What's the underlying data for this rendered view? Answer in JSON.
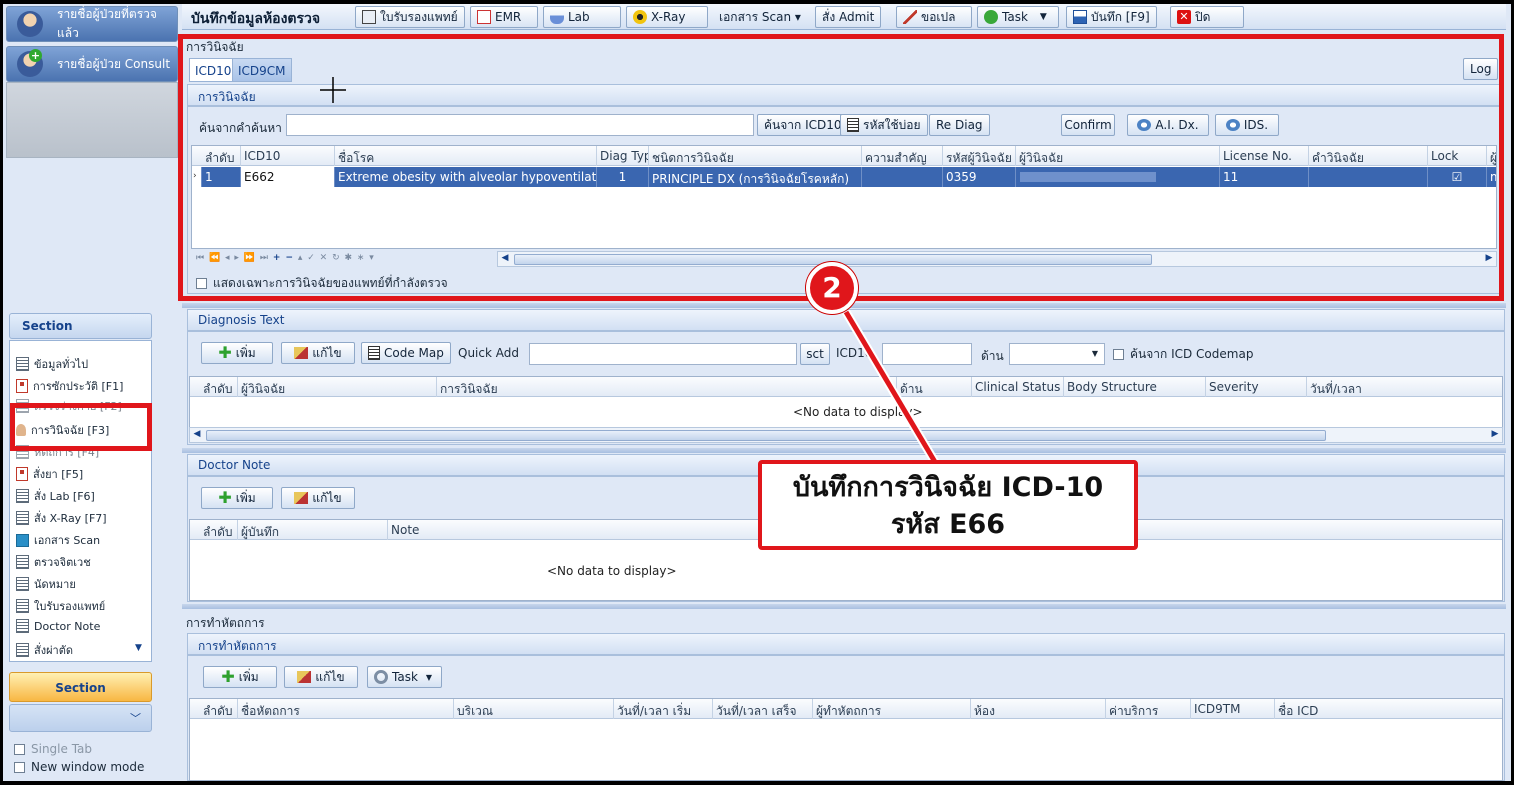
{
  "sidebar": {
    "patients_checked": "รายชื่อผู้ป่วยที่ตรวจแล้ว",
    "patients_consult": "รายชื่อผู้ป่วย Consult",
    "section_header": "Section",
    "items": [
      {
        "label": "ข้อมูลทั่วไป",
        "icon": "calendar-icon"
      },
      {
        "label": "การซักประวัติ [F1]",
        "icon": "clipboard-icon"
      },
      {
        "label": "ตรวจร่างกาย [F2]",
        "icon": "document-icon"
      },
      {
        "label": "การวินิจฉัย [F3]",
        "icon": "doctor-icon"
      },
      {
        "label": "หัตถการ [F4]",
        "icon": "document-icon"
      },
      {
        "label": "สั่งยา [F5]",
        "icon": "medicine-icon"
      },
      {
        "label": "สั่ง Lab  [F6]",
        "icon": "document-icon"
      },
      {
        "label": "สั่ง X-Ray  [F7]",
        "icon": "document-icon"
      },
      {
        "label": "เอกสาร Scan",
        "icon": "scan-icon"
      },
      {
        "label": "ตรวจจิตเวช",
        "icon": "document-icon"
      },
      {
        "label": "นัดหมาย",
        "icon": "document-icon"
      },
      {
        "label": "ใบรับรองแพทย์",
        "icon": "document-icon"
      },
      {
        "label": "Doctor Note",
        "icon": "document-icon"
      },
      {
        "label": "สั่งผ่าตัด",
        "icon": "document-icon"
      }
    ],
    "active_section": "Section",
    "single_tab": "Single Tab",
    "new_window_mode": "New window mode"
  },
  "toolbar": {
    "title": "บันทึกข้อมูลห้องตรวจ",
    "buttons": [
      {
        "label": "ใบรับรองแพทย์",
        "icon": "certificate-icon"
      },
      {
        "label": "EMR",
        "icon": "emr-icon"
      },
      {
        "label": "Lab",
        "icon": "flask-icon"
      },
      {
        "label": "X-Ray",
        "icon": "radiation-icon"
      },
      {
        "label": "เอกสาร Scan ▾",
        "icon": "scan-icon"
      },
      {
        "label": "สั่ง Admit",
        "icon": "admit-icon"
      },
      {
        "label": "ขอเปล",
        "icon": "stretcher-icon"
      },
      {
        "label": "Task",
        "icon": "task-icon"
      },
      {
        "label": "บันทึก [F9]",
        "icon": "save-icon"
      },
      {
        "label": "ปิด",
        "icon": "close-icon"
      }
    ]
  },
  "diagnosis": {
    "section_title": "การวินิจฉัย",
    "tabs": [
      "ICD10",
      "ICD9CM"
    ],
    "log_button": "Log",
    "subpanel_title": "การวินิจฉัย",
    "search_label": "ค้นจากคำค้นหา",
    "search_value": "",
    "btn_search_icd10": "ค้นจาก ICD10",
    "btn_frequent": "รหัสใช้บ่อย",
    "btn_rediag": "Re Diag",
    "btn_confirm": "Confirm",
    "btn_ai": "A.I. Dx.",
    "btn_ids": "IDS.",
    "columns": [
      "ลำดับ",
      "ICD10",
      "ชื่อโรค",
      "Diag Typ",
      "ชนิดการวินิจฉัย",
      "ความสำคัญ",
      "รหัสผู้วินิจฉัย",
      "ผู้วินิจฉัย",
      "License No.",
      "คำวินิจฉัย",
      "Lock",
      "ผู้"
    ],
    "rows": [
      {
        "seq": "1",
        "icd10": "E662",
        "name": "Extreme obesity with alveolar hypoventilation",
        "diag_type": "1",
        "kind": "PRINCIPLE DX (การวินิจฉัยโรคหลัก)",
        "importance": "",
        "doctor_code": "0359",
        "doctor": "",
        "license": "11",
        "diag_text": "",
        "lock": "☑",
        "extra": "m"
      }
    ],
    "show_only_mine": "แสดงเฉพาะการวินิจฉัยของแพทย์ที่กำลังตรวจ"
  },
  "diagnosis_text": {
    "title": "Diagnosis Text",
    "btn_add": "เพิ่ม",
    "btn_edit": "แก้ไข",
    "btn_codemap": "Code Map",
    "quick_add_label": "Quick Add",
    "btn_sct": "sct",
    "icd10_label": "ICD10",
    "side_label": "ด้าน",
    "codemap_check": "ค้นจาก ICD Codemap",
    "columns": [
      "ลำดับ",
      "ผู้วินิจฉัย",
      "การวินิจฉัย",
      "ด้าน",
      "Clinical Status",
      "Body Structure",
      "Severity",
      "วันที่/เวลา"
    ],
    "empty": "<No data to display>"
  },
  "doctor_note": {
    "title": "Doctor Note",
    "btn_add": "เพิ่ม",
    "btn_edit": "แก้ไข",
    "columns": [
      "ลำดับ",
      "ผู้บันทึก",
      "Note"
    ],
    "empty": "<No data to display>"
  },
  "procedure": {
    "section_title": "การทำหัตถการ",
    "subpanel_title": "การทำหัตถการ",
    "btn_add": "เพิ่ม",
    "btn_edit": "แก้ไข",
    "btn_task": "Task",
    "columns": [
      "ลำดับ",
      "ชื่อหัตถการ",
      "บริเวณ",
      "วันที่/เวลา เริ่ม",
      "วันที่/เวลา เสร็จ",
      "ผู้ทำหัตถการ",
      "ห้อง",
      "ค่าบริการ",
      "ICD9TM",
      "ชื่อ ICD"
    ]
  },
  "annotation": {
    "step_number": "2",
    "callout_line1": "บันทึกการวินิจฉัย ICD-10",
    "callout_line2": "รหัส E66",
    "colors": {
      "red": "#e0161b"
    }
  }
}
